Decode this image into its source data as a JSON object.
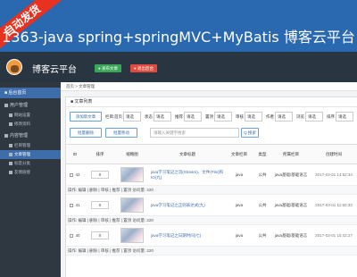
{
  "banner": {
    "ribbon": "自动发货",
    "title": "1363-java spring+springMVC+MyBatis 博客云平台"
  },
  "topbar": {
    "app_title": "博客云平台",
    "publish_label": "● 发布文章",
    "logout_label": "● 退出后台"
  },
  "sidebar": {
    "header": "■ 后台首页",
    "groups": [
      {
        "label": "用户管理",
        "items": [
          "网站设置",
          "修改资料"
        ]
      },
      {
        "label": "内容管理",
        "items": [
          "栏目管理",
          "文章管理",
          "标签分类",
          "友情链接"
        ]
      }
    ]
  },
  "breadcrumb": "首页 > 文章管理",
  "panel_title": "■ 文章列表",
  "filters": {
    "add_button": "添加新文章",
    "labels": [
      "栏目:",
      "首页",
      "状态",
      "推荐",
      "置顶",
      "审核",
      "作者",
      "浏览",
      "排序",
      "类型"
    ],
    "select_text": "请选",
    "batch_delete": "批量删除",
    "batch_move": "批量移动",
    "search_placeholder": "请输入关键字搜索",
    "search_button": "Q 搜索"
  },
  "table": {
    "headers": [
      "ID",
      "排序",
      "缩略图",
      "文章标题",
      "文章栏目",
      "类型",
      "所属栏目",
      "创建时间"
    ],
    "rows": [
      {
        "id": "42",
        "sort": "0",
        "title": "java学习笔记之流(Stream)、文件(File)和IO(九)",
        "category": "java",
        "type": "公共",
        "column": "java基础/基础语言",
        "date": "2017-03-01 14:52:34"
      },
      {
        "id": "41",
        "sort": "0",
        "title": "java学习笔记之正则表达式(九)",
        "category": "java",
        "type": "公共",
        "column": "java基础/基础语言",
        "date": "2017-03-01 11:50:33"
      },
      {
        "id": "40",
        "sort": "0",
        "title": "java学习笔记之日期时间(七)",
        "category": "java",
        "type": "公共",
        "column": "java基础/基础语言",
        "date": "2017-03-01 10:42:27"
      }
    ],
    "action_text": "操作: 编辑 | 删除 | 审核 | 推荐 | 置顶  访问量: 220"
  }
}
